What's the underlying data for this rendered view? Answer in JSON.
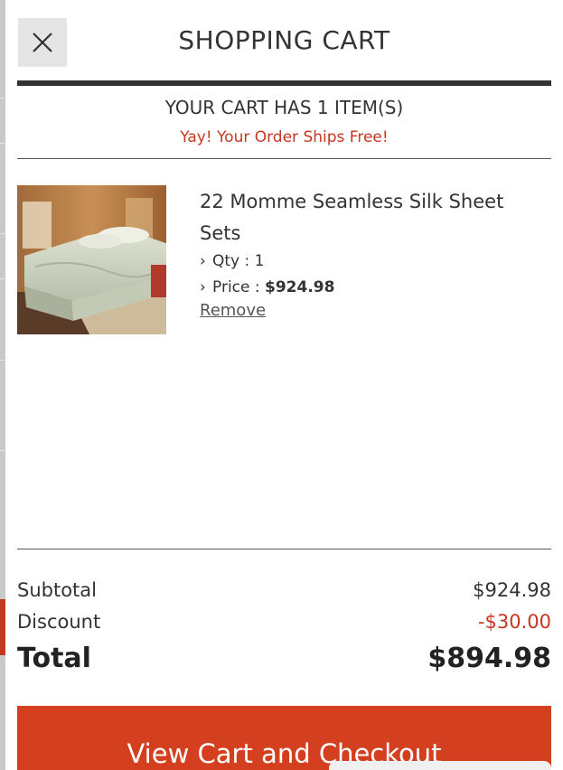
{
  "header": {
    "title": "SHOPPING CART",
    "close_icon": "close-icon"
  },
  "cart": {
    "item_count_text": "YOUR CART HAS 1 ITEM(S)",
    "shipping_message": "Yay! Your Order Ships Free!",
    "items": [
      {
        "name": "22 Momme Seamless Silk Sheet Sets",
        "qty_label": "Qty : 1",
        "price_label": "Price : ",
        "price_value": "$924.98",
        "remove_label": "Remove"
      }
    ]
  },
  "summary": {
    "subtotal_label": "Subtotal",
    "subtotal_value": "$924.98",
    "discount_label": "Discount",
    "discount_value": "-$30.00",
    "total_label": "Total",
    "total_value": "$894.98"
  },
  "checkout_label": "View Cart and Checkout",
  "colors": {
    "accent": "#d4401f",
    "discount": "#c8361f",
    "text": "#333333"
  }
}
